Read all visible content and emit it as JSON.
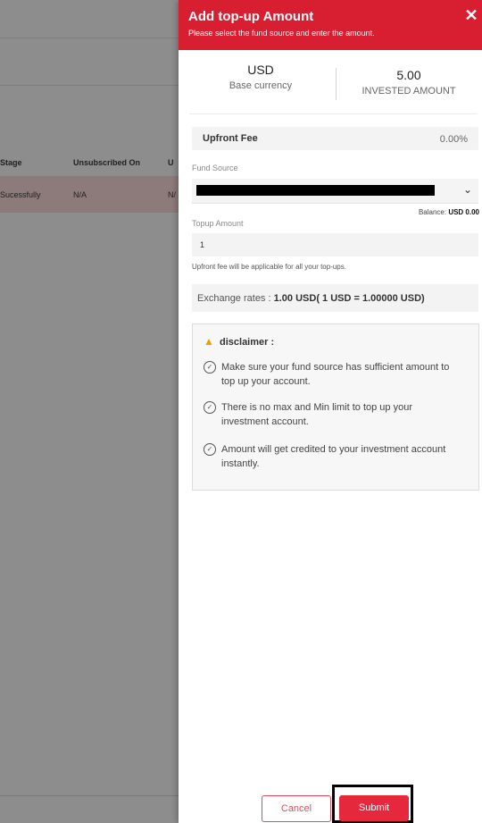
{
  "background": {
    "table_headers": [
      "Stage",
      "Unsubscribed On",
      "U"
    ],
    "row": [
      "Sucessfully",
      "N/A",
      "N/"
    ]
  },
  "drawer": {
    "title": "Add top-up Amount",
    "subtitle": "Please select the fund source and enter the amount.",
    "close_icon": "close-icon",
    "summary": {
      "currency_value": "USD",
      "currency_label": "Base currency",
      "invested_value": "5.00",
      "invested_label": "INVESTED AMOUNT"
    },
    "upfront_fee": {
      "label": "Upfront Fee",
      "value": "0.00%"
    },
    "fund_source": {
      "label": "Fund Source",
      "balance_label": "Balance:",
      "balance_value": "USD 0.00"
    },
    "topup": {
      "label": "Topup Amount",
      "value": "1",
      "hint": "Upfront fee will be applicable for all your top-ups."
    },
    "exchange": {
      "label": "Exchange rates :",
      "value": "1.00 USD( 1 USD = 1.00000 USD)"
    },
    "disclaimer": {
      "title": "disclaimer :",
      "items": [
        "Make sure your fund source has sufficient amount to top up your account.",
        "There is no max and Min limit to top up your investment account.",
        "Amount will get credited to your investment account instantly."
      ]
    },
    "buttons": {
      "cancel": "Cancel",
      "submit": "Submit"
    },
    "colors": {
      "brand": "#d81f32",
      "submit": "#e6283d"
    }
  }
}
